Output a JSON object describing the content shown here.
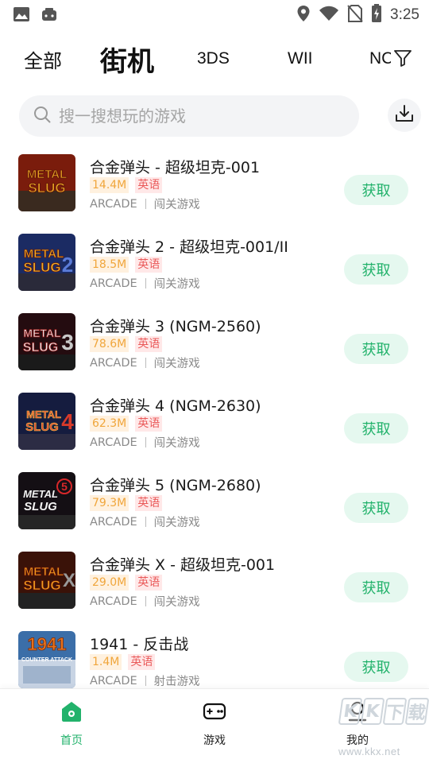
{
  "status_bar": {
    "time": "3:25",
    "left_icons": [
      "image-icon",
      "game-controller-icon"
    ],
    "right_icons": [
      "location-icon",
      "wifi-icon",
      "no-sim-icon",
      "battery-charging-icon"
    ]
  },
  "tabs": [
    {
      "label": "全部",
      "active": false
    },
    {
      "label": "街机",
      "active": true
    },
    {
      "label": "3DS",
      "active": false
    },
    {
      "label": "WII",
      "active": false
    },
    {
      "label": "NC",
      "active": false
    }
  ],
  "search": {
    "placeholder": "搜一搜想玩的游戏"
  },
  "games": [
    {
      "title": "合金弹头 - 超级坦克-001",
      "size": "14.4M",
      "language": "英语",
      "platform": "ARCADE",
      "genre": "闯关游戏",
      "action": "获取",
      "cover_text": [
        "METAL",
        "SLUG"
      ],
      "cover_color": "#7a1c0c"
    },
    {
      "title": "合金弹头 2 - 超级坦克-001/II",
      "size": "18.5M",
      "language": "英语",
      "platform": "ARCADE",
      "genre": "闯关游戏",
      "action": "获取",
      "cover_text": [
        "METAL",
        "SLUG",
        "2"
      ],
      "cover_color": "#1b2b63"
    },
    {
      "title": "合金弹头 3 (NGM-2560)",
      "size": "78.6M",
      "language": "英语",
      "platform": "ARCADE",
      "genre": "闯关游戏",
      "action": "获取",
      "cover_text": [
        "METAL",
        "SLUG",
        "3"
      ],
      "cover_color": "#240c10"
    },
    {
      "title": "合金弹头 4 (NGM-2630)",
      "size": "62.3M",
      "language": "英语",
      "platform": "ARCADE",
      "genre": "闯关游戏",
      "action": "获取",
      "cover_text": [
        "METAL",
        "SLUG",
        "4"
      ],
      "cover_color": "#151c3f"
    },
    {
      "title": "合金弹头 5 (NGM-2680)",
      "size": "79.3M",
      "language": "英语",
      "platform": "ARCADE",
      "genre": "闯关游戏",
      "action": "获取",
      "cover_text": [
        "METAL",
        "SLUG",
        "5"
      ],
      "cover_color": "#140f14"
    },
    {
      "title": "合金弹头 X - 超级坦克-001",
      "size": "29.0M",
      "language": "英语",
      "platform": "ARCADE",
      "genre": "闯关游戏",
      "action": "获取",
      "cover_text": [
        "METAL",
        "SLUG",
        "X"
      ],
      "cover_color": "#3a1208"
    },
    {
      "title": "1941 - 反击战",
      "size": "1.4M",
      "language": "英语",
      "platform": "ARCADE",
      "genre": "射击游戏",
      "action": "获取",
      "cover_text": [
        "1941",
        "COUNTER ATTACK"
      ],
      "cover_color": "#3b6ea8"
    }
  ],
  "bottom_nav": [
    {
      "label": "首页",
      "icon": "home-icon",
      "active": true
    },
    {
      "label": "游戏",
      "icon": "gamepad-icon",
      "active": false
    },
    {
      "label": "我的",
      "icon": "user-icon",
      "active": false
    }
  ],
  "watermark": {
    "logo": [
      "K",
      "K",
      "下",
      "载"
    ],
    "url": "www.kkx.net"
  },
  "colors": {
    "accent": "#22b26b",
    "accent_bg": "#e5f8ef",
    "size_badge_text": "#f0a63c",
    "lang_badge_text": "#ea5a5a"
  }
}
